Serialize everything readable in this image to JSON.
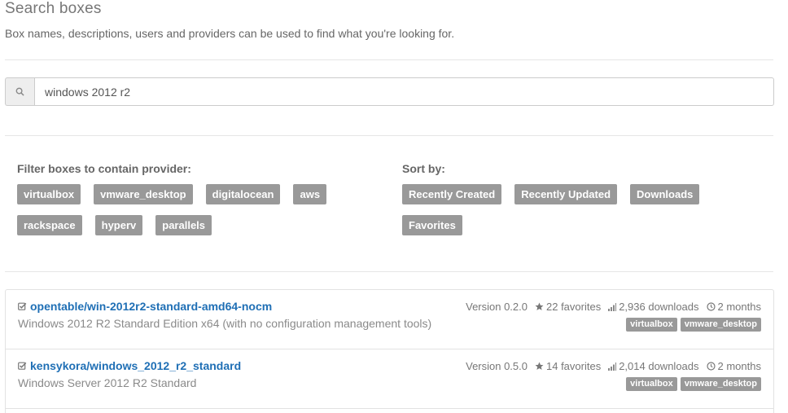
{
  "header": {
    "title": "Search boxes",
    "subtitle": "Box names, descriptions, users and providers can be used to find what you're looking for."
  },
  "search": {
    "value": "windows 2012 r2"
  },
  "filters": {
    "provider_heading": "Filter boxes to contain provider:",
    "providers_row1": [
      "virtualbox",
      "vmware_desktop",
      "digitalocean",
      "aws"
    ],
    "providers_row2": [
      "rackspace",
      "hyperv",
      "parallels"
    ],
    "sort_heading": "Sort by:",
    "sort_row1": [
      "Recently Created",
      "Recently Updated",
      "Downloads"
    ],
    "sort_row2": [
      "Favorites"
    ]
  },
  "results": [
    {
      "name": "opentable/win-2012r2-standard-amd64-nocm",
      "description": "Windows 2012 R2 Standard Edition x64 (with no configuration management tools)",
      "version": "Version 0.2.0",
      "favorites": "22 favorites",
      "downloads": "2,936 downloads",
      "age": "2 months",
      "providers": [
        "virtualbox",
        "vmware_desktop"
      ]
    },
    {
      "name": "kensykora/windows_2012_r2_standard",
      "description": "Windows Server 2012 R2 Standard",
      "version": "Version 0.5.0",
      "favorites": "14 favorites",
      "downloads": "2,014 downloads",
      "age": "2 months",
      "providers": [
        "virtualbox",
        "vmware_desktop"
      ]
    }
  ],
  "colors": {
    "tag_bg": "#999999",
    "link": "#1f6fb5"
  }
}
